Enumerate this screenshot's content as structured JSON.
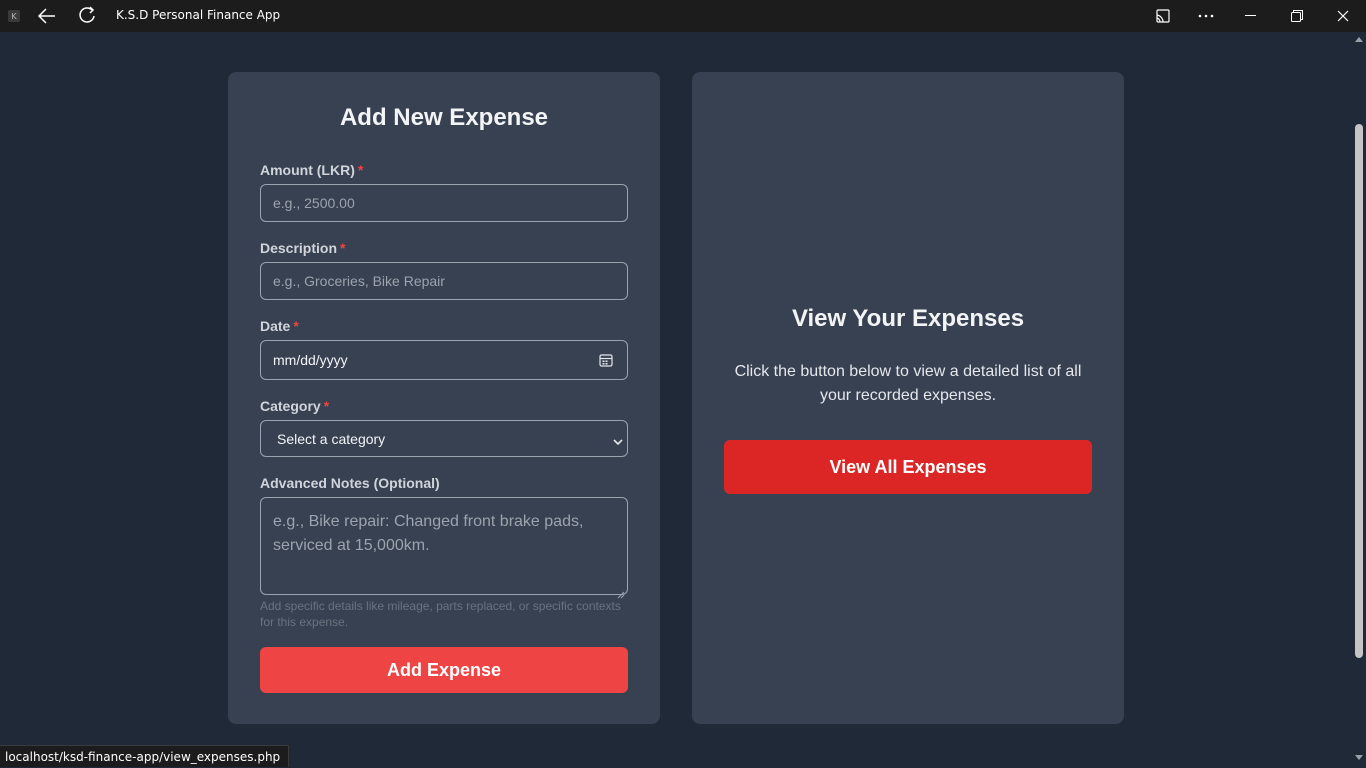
{
  "window": {
    "title": "K.S.D Personal Finance App",
    "app_icon_letter": "K"
  },
  "form": {
    "title": "Add New Expense",
    "required_mark": "*",
    "amount": {
      "label": "Amount (LKR)",
      "placeholder": "e.g., 2500.00",
      "value": ""
    },
    "description": {
      "label": "Description",
      "placeholder": "e.g., Groceries, Bike Repair",
      "value": ""
    },
    "date": {
      "label": "Date",
      "value": "mm/dd/yyyy"
    },
    "category": {
      "label": "Category",
      "selected": "Select a category"
    },
    "notes": {
      "label": "Advanced Notes (Optional)",
      "placeholder": "e.g., Bike repair: Changed front brake pads, serviced at 15,000km.",
      "help": "Add specific details like mileage, parts replaced, or specific contexts for this expense."
    },
    "submit_label": "Add Expense"
  },
  "view_panel": {
    "title": "View Your Expenses",
    "text": "Click the button below to view a detailed list of all your recorded expenses.",
    "button_label": "View All Expenses"
  },
  "status_bar": {
    "url": "localhost/ksd-finance-app/view_expenses.php"
  },
  "colors": {
    "background": "#1f2937",
    "card": "#374151",
    "accent_red": "#ef4444",
    "accent_red_dark": "#dc2626",
    "required": "#ef4444"
  }
}
